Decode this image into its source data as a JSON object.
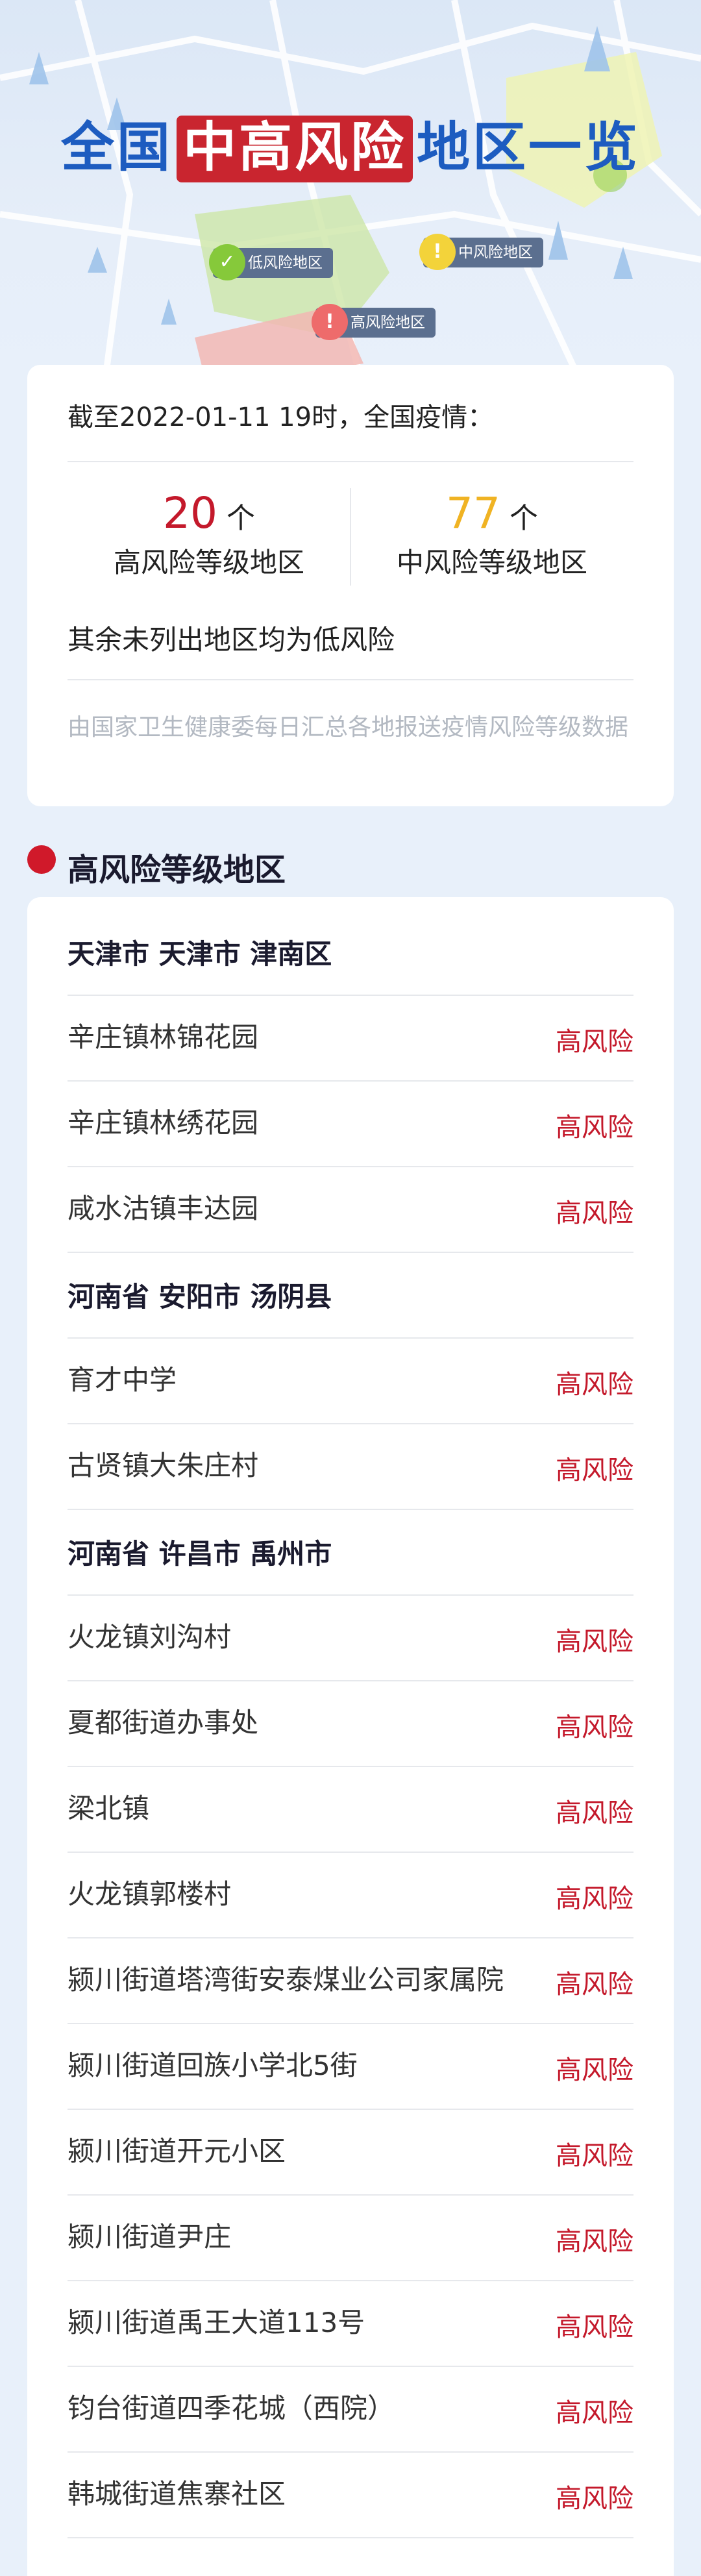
{
  "header": {
    "title_pre": "全国",
    "title_highlight": "中高风险",
    "title_post": "地区一览",
    "legend": {
      "low": "低风险地区",
      "medium": "中风险地区",
      "high": "高风险地区"
    }
  },
  "summary": {
    "as_of": "截至2022-01-11 19时，全国疫情：",
    "high": {
      "count": "20",
      "unit": "个",
      "label": "高风险等级地区"
    },
    "medium": {
      "count": "77",
      "unit": "个",
      "label": "中风险等级地区"
    },
    "rest_note": "其余未列出地区均为低风险",
    "source": "由国家卫生健康委每日汇总各地报送疫情风险等级数据"
  },
  "colors": {
    "high": "#c4192b",
    "medium": "#f0b323",
    "low": "#86c93a",
    "title_blue": "#1d5cc0"
  },
  "section": {
    "title": "高风险等级地区"
  },
  "regions": [
    {
      "type": "group",
      "name": "天津市 天津市 津南区"
    },
    {
      "type": "item",
      "name": "辛庄镇林锦花园",
      "risk": "高风险"
    },
    {
      "type": "item",
      "name": "辛庄镇林绣花园",
      "risk": "高风险"
    },
    {
      "type": "item",
      "name": "咸水沽镇丰达园",
      "risk": "高风险"
    },
    {
      "type": "group",
      "name": "河南省 安阳市 汤阴县"
    },
    {
      "type": "item",
      "name": "育才中学",
      "risk": "高风险"
    },
    {
      "type": "item",
      "name": "古贤镇大朱庄村",
      "risk": "高风险"
    },
    {
      "type": "group",
      "name": "河南省 许昌市 禹州市"
    },
    {
      "type": "item",
      "name": "火龙镇刘沟村",
      "risk": "高风险"
    },
    {
      "type": "item",
      "name": "夏都街道办事处",
      "risk": "高风险"
    },
    {
      "type": "item",
      "name": "梁北镇",
      "risk": "高风险"
    },
    {
      "type": "item",
      "name": "火龙镇郭楼村",
      "risk": "高风险"
    },
    {
      "type": "item",
      "name": "颍川街道塔湾街安泰煤业公司家属院",
      "risk": "高风险"
    },
    {
      "type": "item",
      "name": "颍川街道回族小学北5街",
      "risk": "高风险"
    },
    {
      "type": "item",
      "name": "颍川街道开元小区",
      "risk": "高风险"
    },
    {
      "type": "item",
      "name": "颍川街道尹庄",
      "risk": "高风险"
    },
    {
      "type": "item",
      "name": "颍川街道禹王大道113号",
      "risk": "高风险"
    },
    {
      "type": "item",
      "name": "钧台街道四季花城（西院）",
      "risk": "高风险"
    },
    {
      "type": "item",
      "name": "韩城街道焦寨社区",
      "risk": "高风险"
    }
  ]
}
